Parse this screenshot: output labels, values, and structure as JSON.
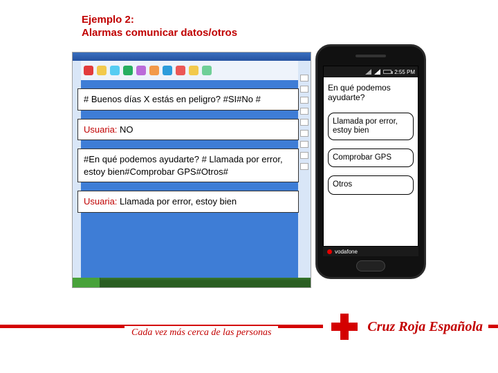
{
  "title": {
    "line1": "Ejemplo 2:",
    "line2": "Alarmas comunicar datos/otros"
  },
  "conversation": {
    "system1": "# Buenos días X estás en peligro? #SI#No #",
    "user1_label": "Usuaria:",
    "user1_text": " NO",
    "system2": "#En qué podemos ayudarte? # Llamada por error, estoy bien#Comprobar GPS#Otros#",
    "user2_label": "Usuaria:",
    "user2_text": " Llamada por error, estoy bien"
  },
  "phone": {
    "time": "2:55 PM",
    "prompt": "En qué podemos ayudarte?",
    "options": [
      "Llamada por error, estoy bien",
      "Comprobar GPS",
      "Otros"
    ],
    "carrier": "vodafone"
  },
  "footer": {
    "slogan": "Cada vez más cerca de las personas",
    "org": "Cruz Roja Española"
  },
  "toolbar_colors": [
    "#e23b3b",
    "#f2c94c",
    "#56ccf2",
    "#27ae60",
    "#bb6bd9",
    "#f2994a",
    "#2d9cdb",
    "#eb5757",
    "#f2c94c",
    "#6fcf97"
  ]
}
